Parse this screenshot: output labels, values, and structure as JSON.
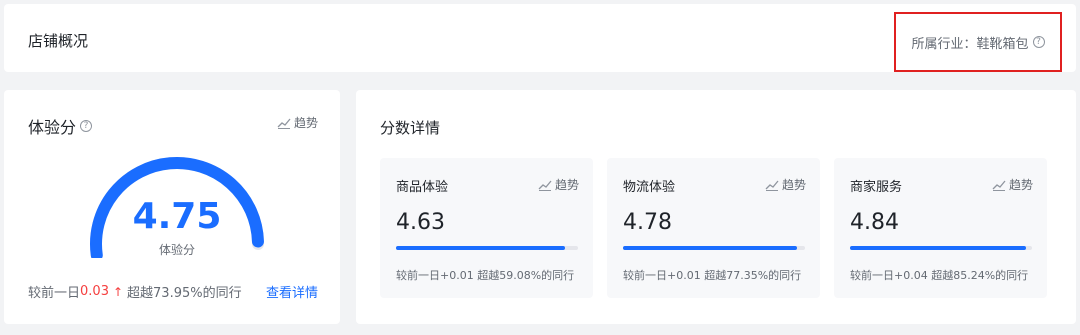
{
  "header": {
    "title": "店铺概况",
    "industry": "所属行业：鞋靴箱包"
  },
  "score_card": {
    "title": "体验分",
    "trend_label": "趋势",
    "score": "4.75",
    "score_max": 5,
    "score_value": 4.75,
    "score_label": "体验分",
    "compare_prefix": "较前一日",
    "compare_delta": "0.03",
    "compare_arrow": "↑",
    "compare_suffix": "超越73.95%的同行",
    "detail_link": "查看详情"
  },
  "details": {
    "title": "分数详情",
    "items": [
      {
        "title": "商品体验",
        "trend_label": "趋势",
        "value": "4.63",
        "progress": 0.926,
        "compare": "较前一日+0.01 超越59.08%的同行"
      },
      {
        "title": "物流体验",
        "trend_label": "趋势",
        "value": "4.78",
        "progress": 0.956,
        "compare": "较前一日+0.01 超越77.35%的同行"
      },
      {
        "title": "商家服务",
        "trend_label": "趋势",
        "value": "4.84",
        "progress": 0.968,
        "compare": "较前一日+0.04 超越85.24%的同行"
      }
    ]
  },
  "colors": {
    "accent": "#1a6dff",
    "up_red": "#f53f3f",
    "highlight_border": "#e02020"
  }
}
